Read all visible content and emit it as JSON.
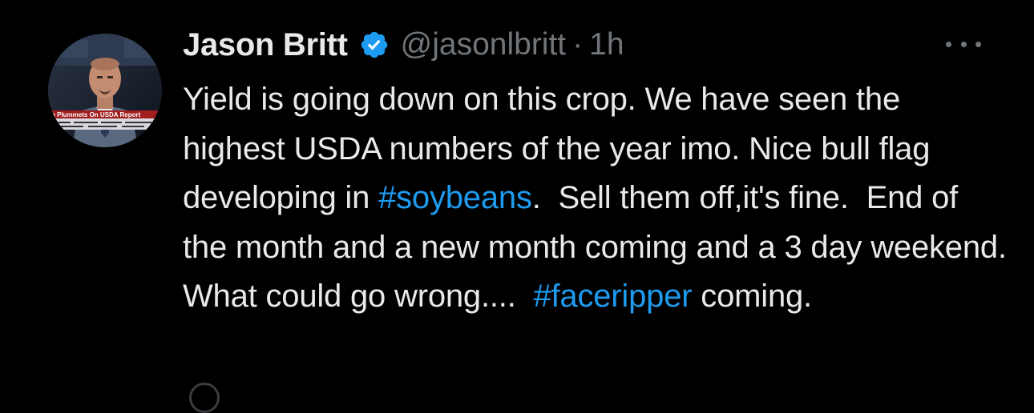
{
  "tweet": {
    "author": {
      "name": "Jason Britt",
      "handle": "@jasonlbritt",
      "verified": true,
      "avatar_ticker": "n Plummets On USDA Report"
    },
    "separator": "·",
    "time": "1h",
    "text": {
      "part1": "Yield is going down on this crop. We have seen the highest USDA numbers of the year imo. Nice bull flag developing in ",
      "hashtag1": "#soybeans",
      "part2": ".  Sell them off,it's fine.  End of the month and a new month coming and a 3 day weekend. What could go wrong....  ",
      "hashtag2": "#faceripper",
      "part3": " coming."
    }
  },
  "colors": {
    "background": "#000000",
    "text": "#e7e9ea",
    "secondary": "#71767b",
    "link": "#1d9bf0",
    "verified_badge": "#1d9bf0"
  },
  "icons": {
    "verified": "verified-badge-icon",
    "more": "more-options-icon"
  }
}
